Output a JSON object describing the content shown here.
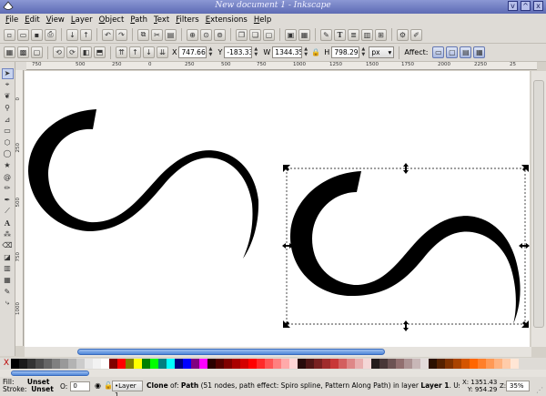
{
  "window": {
    "title": "New document 1 - Inkscape",
    "controls": [
      "v",
      "^",
      "x"
    ]
  },
  "menu": [
    "File",
    "Edit",
    "View",
    "Layer",
    "Object",
    "Path",
    "Text",
    "Filters",
    "Extensions",
    "Help"
  ],
  "toolbar": {
    "x_label": "X",
    "x_value": "747.666",
    "y_label": "Y",
    "y_value": "-183.33",
    "w_label": "W",
    "w_value": "1344.35",
    "h_label": "H",
    "h_value": "798.297",
    "unit": "px",
    "affect_label": "Affect:"
  },
  "ruler": {
    "h_ticks": [
      "750",
      "500",
      "250",
      "0",
      "250",
      "500",
      "750",
      "1000",
      "1250",
      "1500",
      "1750",
      "2000",
      "2250",
      "25"
    ],
    "v_ticks": [
      "0",
      "250",
      "500",
      "750",
      "1000"
    ]
  },
  "palette": {
    "none_glyph": "X",
    "colors": [
      "#000000",
      "#1a1a1a",
      "#333333",
      "#4d4d4d",
      "#666666",
      "#808080",
      "#999999",
      "#b3b3b3",
      "#cccccc",
      "#e6e6e6",
      "#f2f2f2",
      "#ffffff",
      "#800000",
      "#ff0000",
      "#808000",
      "#ffff00",
      "#008000",
      "#00ff00",
      "#008080",
      "#00ffff",
      "#000080",
      "#0000ff",
      "#800080",
      "#ff00ff",
      "#2b0000",
      "#550000",
      "#800000",
      "#aa0000",
      "#d40000",
      "#ff0000",
      "#ff2a2a",
      "#ff5555",
      "#ff8080",
      "#ffaaaa",
      "#ffd5d5",
      "#280b0b",
      "#501616",
      "#782121",
      "#a02c2c",
      "#c83737",
      "#d35f5f",
      "#de8787",
      "#e9afaf",
      "#f4d7d7",
      "#241c1c",
      "#483737",
      "#6c5353",
      "#916f6f",
      "#ac9393",
      "#c8b7b7",
      "#e3dbdb",
      "#2b1100",
      "#552200",
      "#803300",
      "#aa4400",
      "#d45500",
      "#ff6600",
      "#ff7f2a",
      "#ff9955",
      "#ffb380",
      "#ffccaa",
      "#ffe6d5"
    ]
  },
  "status": {
    "fill_label": "Fill:",
    "fill_value": "Unset",
    "stroke_label": "Stroke:",
    "stroke_value": "Unset",
    "opacity_label": "O:",
    "opacity_value": "0",
    "layer": "Layer 1",
    "message_prefix": "Clone",
    "message_of": " of: ",
    "message_path": "Path",
    "message_rest": " (51 nodes, path effect: Spiro spline, Pattern Along Path) in layer ",
    "message_layer": "Layer 1",
    "message_tail": ". Use Shift+D to look up original. Click selection to toggle scale/rotation handles.",
    "x_label": "X:",
    "x_value": "1351.43",
    "y_label": "Y:",
    "y_value": "954.29",
    "zoom_label": "Z:",
    "zoom_value": "35%"
  },
  "toolbox": [
    "selector-tool",
    "node-tool",
    "tweak-tool",
    "zoom-tool",
    "measure-tool",
    "rect-tool",
    "3dbox-tool",
    "ellipse-tool",
    "star-tool",
    "spiral-tool",
    "pencil-tool",
    "pen-tool",
    "calligraphy-tool",
    "text-tool",
    "spray-tool",
    "eraser-tool",
    "bucket-tool",
    "gradient-tool",
    "mesh-tool",
    "dropper-tool",
    "connector-tool"
  ]
}
